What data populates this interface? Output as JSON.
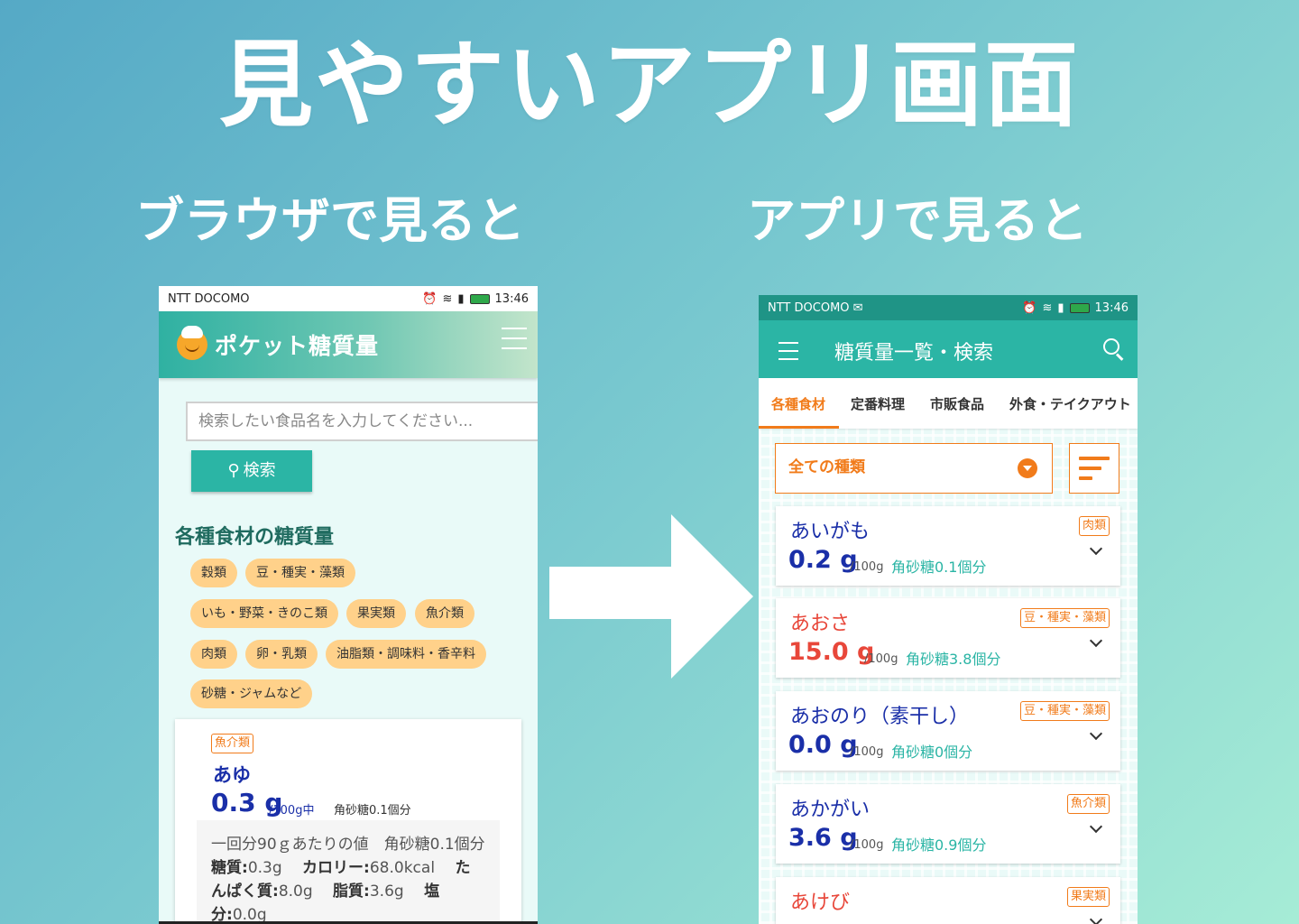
{
  "headline": "見やすいアプリ画面",
  "left_caption": "ブラウザで見ると",
  "right_caption": "アプリで見ると",
  "browser": {
    "status": {
      "carrier": "NTT DOCOMO",
      "time": "13:46"
    },
    "brand": "ポケット糖質量",
    "search_placeholder": "検索したい食品名を入力してください...",
    "search_button": "検索",
    "section_title": "各種食材の糖質量",
    "chips": [
      "穀類",
      "豆・種実・藻類",
      "いも・野菜・きのこ類",
      "果実類",
      "魚介類",
      "肉類",
      "卵・乳類",
      "油脂類・調味料・香辛料",
      "砂糖・ジャムなど"
    ],
    "card": {
      "tag": "魚介類",
      "name": "あゆ",
      "value": "0.3 g",
      "unit": "/100g中",
      "sugar_cubes": "角砂糖0.1個分",
      "serving_line": "一回分90ｇあたりの値　角砂糖0.1個分",
      "carb_label": "糖質:",
      "carb_value": "0.3g",
      "cal_label": "カロリー:",
      "cal_value": "68.0kcal",
      "protein_label": "たんぱく質:",
      "protein_value": "8.0g",
      "fat_label": "脂質:",
      "fat_value": "3.6g",
      "salt_label": "塩分:",
      "salt_value": "0.0g"
    }
  },
  "app": {
    "status": {
      "carrier": "NTT DOCOMO",
      "time": "13:46"
    },
    "title": "糖質量一覧・検索",
    "tabs": [
      "各種食材",
      "定番料理",
      "市販食品",
      "外食・テイクアウト"
    ],
    "active_tab": "各種食材",
    "filter_value": "全ての種類",
    "unit": "/100g",
    "colors": {
      "primary": "#2bb5a5",
      "accent": "#f17b1a",
      "low": "#1a2fa8",
      "high": "#e8473a"
    },
    "foods": [
      {
        "name": "あいがも",
        "value": "0.2 g",
        "sugar": "角砂糖0.1個分",
        "tag": "肉類",
        "level": "low"
      },
      {
        "name": "あおさ",
        "value": "15.0 g",
        "sugar": "角砂糖3.8個分",
        "tag": "豆・種実・藻類",
        "level": "high"
      },
      {
        "name": "あおのり（素干し）",
        "value": "0.0 g",
        "sugar": "角砂糖0個分",
        "tag": "豆・種実・藻類",
        "level": "low"
      },
      {
        "name": "あかがい",
        "value": "3.6 g",
        "sugar": "角砂糖0.9個分",
        "tag": "魚介類",
        "level": "low"
      },
      {
        "name": "あけび",
        "value": "",
        "sugar": "",
        "tag": "果実類",
        "level": "high"
      }
    ]
  }
}
